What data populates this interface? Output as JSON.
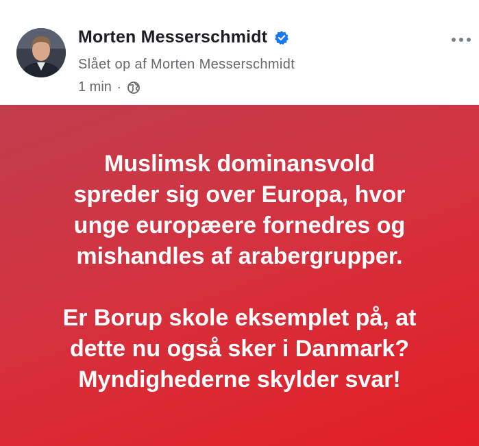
{
  "post": {
    "author": {
      "name": "Morten Messerschmidt",
      "verified": true,
      "avatar": "profile-photo"
    },
    "subtitle": "Slået op af Morten Messerschmidt",
    "timestamp": "1 min",
    "separator": "·",
    "audience_icon": "globe-icon",
    "more_icon": "more-options-icon",
    "banner": {
      "background_colors": [
        "#c13d4d",
        "#d4323f",
        "#e31e24"
      ],
      "text_color": "#ffffff",
      "paragraph1": [
        "Muslimsk dominansvold",
        "spreder sig over Europa, hvor",
        "unge europæere fornedres og",
        "mishandles af arabergrupper."
      ],
      "paragraph2": [
        "Er Borup skole eksemplet på, at",
        "dette nu også sker i Danmark?",
        "Myndighederne skylder svar!"
      ]
    }
  },
  "colors": {
    "verified_badge": "#1877f2",
    "secondary_text": "#65676b",
    "primary_text": "#1c1e21"
  }
}
